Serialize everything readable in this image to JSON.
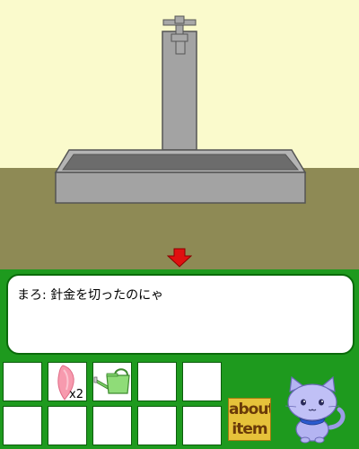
{
  "scene": {
    "name": "water-fountain-room",
    "colors": {
      "wall": "#fafacc",
      "floor": "#8e8a55",
      "stone": "#a0a0a0",
      "stone_dark": "#6a6a6a",
      "arrow": "#e01010"
    }
  },
  "navigation": {
    "down_arrow_icon": "down-arrow-icon"
  },
  "dialog": {
    "text": "まろ: 針金を切ったのにゃ"
  },
  "inventory": {
    "slots": [
      {
        "item": "empty"
      },
      {
        "item": "pink-petal",
        "count": "x2"
      },
      {
        "item": "green-watering-can"
      },
      {
        "item": "empty"
      },
      {
        "item": "empty"
      },
      {
        "item": "empty"
      },
      {
        "item": "empty"
      },
      {
        "item": "empty"
      },
      {
        "item": "empty"
      },
      {
        "item": "empty"
      }
    ]
  },
  "about_button": {
    "line1": "about",
    "line2": "item"
  },
  "character": {
    "icon": "cat-character-icon"
  },
  "panel_color": "#1e9a1e"
}
